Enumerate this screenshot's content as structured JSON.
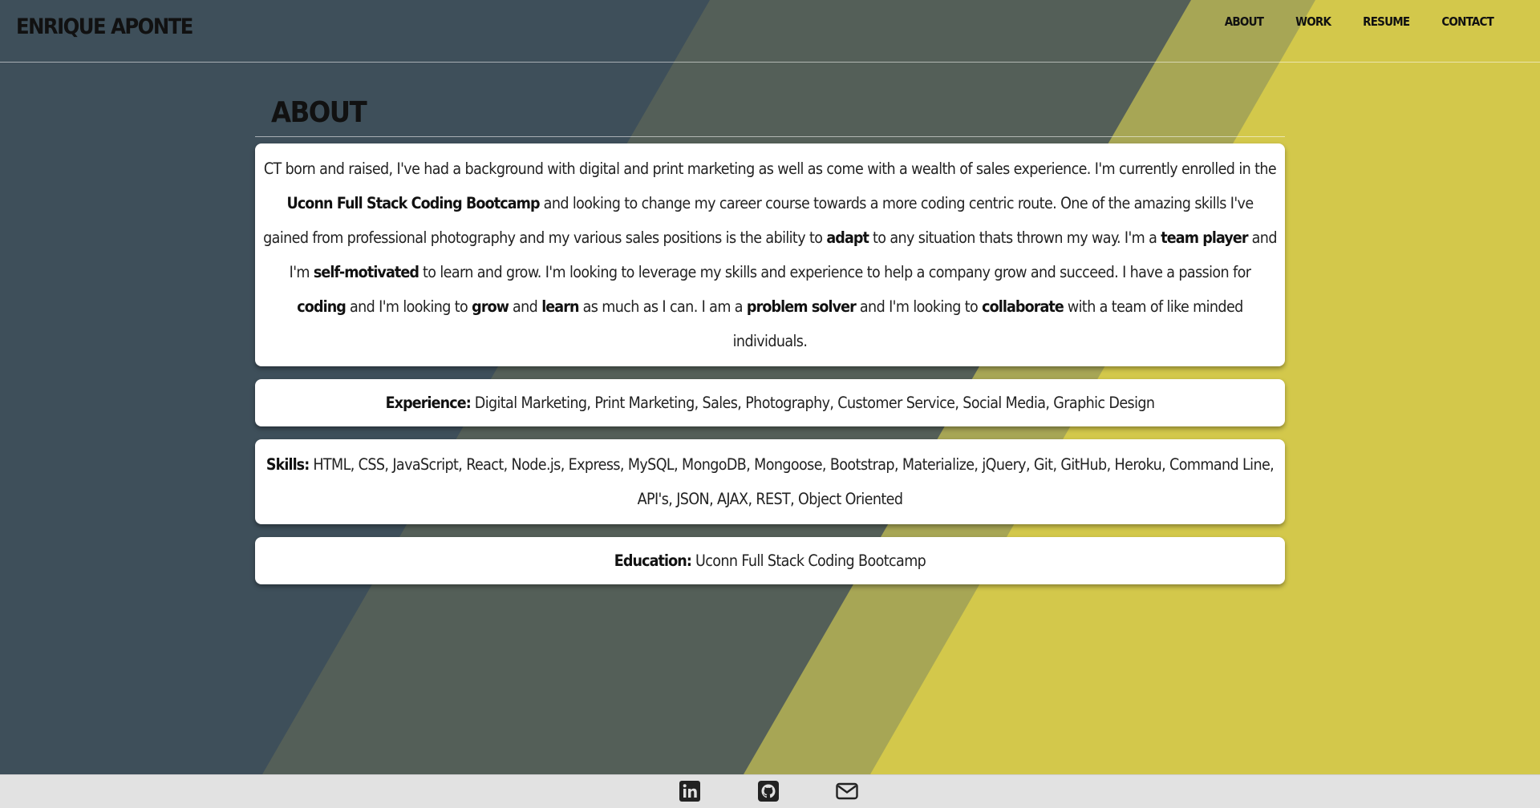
{
  "header": {
    "brand": "ENRIQUE APONTE",
    "nav": [
      {
        "label": "ABOUT"
      },
      {
        "label": "WORK"
      },
      {
        "label": "RESUME"
      },
      {
        "label": "CONTACT"
      }
    ]
  },
  "about": {
    "title": "ABOUT",
    "bio": {
      "p1": "CT born and raised, I've had a background with digital and print marketing as well as come with a wealth of sales experience. I'm currently enrolled in the ",
      "b1": "Uconn Full Stack Coding Bootcamp",
      "p2": " and looking to change my career course towards a more coding centric route. One of the amazing skills I've gained from professional photography and my various sales positions is the ability to ",
      "b2": "adapt",
      "p3": " to any situation thats thrown my way. I'm a ",
      "b3": "team player",
      "p4": " and I'm ",
      "b4": "self-motivated",
      "p5": " to learn and grow. I'm looking to leverage my skills and experience to help a company grow and succeed. I have a passion for ",
      "b5": "coding",
      "p6": " and I'm looking to ",
      "b6": "grow",
      "p7": " and ",
      "b7": "learn",
      "p8": " as much as I can. I am a ",
      "b8": "problem solver",
      "p9": " and I'm looking to ",
      "b9": "collaborate",
      "p10": " with a team of like minded individuals."
    },
    "experience": {
      "label": "Experience:",
      "value": " Digital Marketing, Print Marketing, Sales, Photography, Customer Service, Social Media, Graphic Design"
    },
    "skills": {
      "label": "Skills:",
      "value": " HTML, CSS, JavaScript, React, Node.js, Express, MySQL, MongoDB, Mongoose, Bootstrap, Materialize, jQuery, Git, GitHub, Heroku, Command Line, API's, JSON, AJAX, REST, Object Oriented"
    },
    "education": {
      "label": "Education:",
      "value": " Uconn Full Stack Coding Bootcamp"
    }
  },
  "footer": {
    "icons": [
      "linkedin-icon",
      "github-icon",
      "email-icon"
    ]
  },
  "colors": {
    "slate": "#3e4f5a",
    "olive_dark": "#545f58",
    "olive_light": "#a7a655",
    "yellow": "#d3c84b",
    "footer": "#e2e2e2"
  }
}
